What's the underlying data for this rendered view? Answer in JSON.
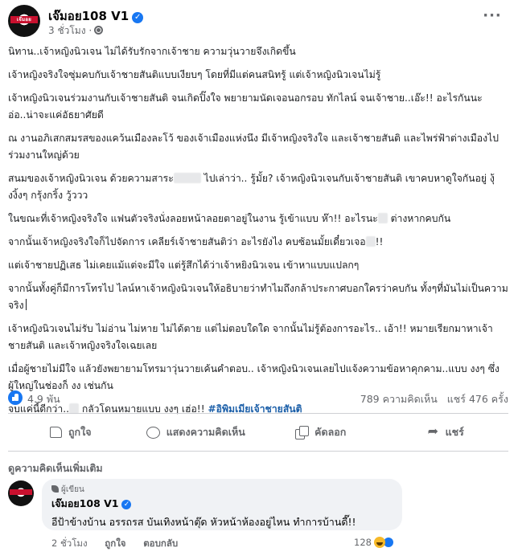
{
  "header": {
    "author": "เจ๊มอย108 V1",
    "avatar_text": "เจ๊มอย",
    "time": "3 ชั่วโมง",
    "more_label": "···"
  },
  "body": {
    "p1": "นิทาน..เจ้าหญิงนิวเจน ไม่ได้รับรักจากเจ้าชาย ความวุ่นวายจึงเกิดขึ้น",
    "p2": "เจ้าหญิงจริงใจซุ่มคบกับเจ้าชายสันติแบบเงียบๆ โดยที่มีแต่คนสนิทรู้ แต่เจ้าหญิงนิวเจนไม่รู้",
    "p3": "เจ้าหญิงนิวเจนร่วมงานกับเจ้าชายสันติ จนเกิดปิ๊งใจ พยายามนัดเจอนอกรอบ ทักไลน์ จนเจ้าชาย..เอ๊ะ!! อะไรกันนะ อ่อ..น่าจะแค่อัธยาศัยดี",
    "p4": "ณ งานอภิเสกสมรสของแคว้นเมืองละโว้ ของเจ้าเมืองแห่งนึง มีเจ้าหญิงจริงใจ และเจ้าชายสันติ และไพร่ฟ้าต่างเมืองไปร่วมงานใหญ่ด้วย",
    "p5a": "สนมของเจ้าหญิงนิวเจน ด้วยความสาระ",
    "p5b": "ไปเล่าว่า.. รู้มั้ย? เจ้าหญิงนิวเจนกับเจ้าชายสันติ เขาคบหาดูใจกันอยู่ งุ้งงิ้งๆ กรุ้งกริ้ง วู้ววว",
    "p6a": "ในขณะที่เจ้าหญิงจริงใจ แฟนตัวจริงนั่งลอยหน้าลอยตาอยู่ในงาน รู้เข้าแบบ ห๊า!! อะไรนะ",
    "p6b": "ต่างหากคบกัน",
    "p7a": "จากนั้นเจ้าหญิงจริงใจก็ไปจัดการ เคลียร์เจ้าชายสันติว่า อะไรยังไง คบซ้อนมั้ยเดี๋ยวเจอ",
    "p7b": "!!",
    "p8": "แต่เจ้าชายปฏิเสธ ไม่เคยแม้แต่จะมีใจ แต่รู้สึกได้ว่าเจ้าหยิงนิวเจน เข้าหาแบบแปลกๆ",
    "p9": "จากนั้นทั้งคู่ก็มีการโทรไป ไลน์หาเจ้าหญิงนิวเจนให้อธิบายว่าทำไมถึงกล้าประกาศบอกใครว่าคบกัน ทั้งๆที่มันไม่เป็นความจริง",
    "p10": "เจ้าหญิงนิวเจนไม่รับ ไม่อ่าน ไม่หาย ไม่ได้ตาย แต่ไม่ตอบใดใด จากนั้นไม่รู้ต้องการอะไร.. เอ้า!! หมายเรียกมาหาเจ้าชายสันติ และเจ้าหญิงจริงใจเฉยเลย",
    "p11": "เมื่อผู้ชายไม่มีใจ แล้วยังพยายามโทรมาวุ่นวายเค้นคำตอบ.. เจ้าหญิงนิวเจนเลยไปแจ้งความข้อหาคุกคาม..แบบ งงๆ ซึ่งผู้ใหญ่ในช่องก็ งง เช่นกัน",
    "p12a": "จบแค่นี้ดีกว่า..",
    "p12b": "กลัวโดนหมายแบบ งงๆ เฮ่อ!!",
    "hashtag": "#อิพิมเมียเจ้าชายสันติ"
  },
  "stats": {
    "reactions": "4.9 พัน",
    "comments": "789 ความคิดเห็น",
    "shares": "แชร์ 476 ครั้ง"
  },
  "actions": {
    "like": "ถูกใจ",
    "comment": "แสดงความคิดเห็น",
    "copy": "คัดลอก",
    "share": "แชร์"
  },
  "comments_section": {
    "more_label": "ดูความคิดเห็นเพิ่มเติม",
    "comment": {
      "badge": "ผู้เขียน",
      "author": "เจ๊มอย108 V1",
      "text": "อีป้าข้างบ้าน อรรถรส บันเทิงหน้าตุ๊ด หัวหน้าห้องอยู่ไหน ทำการบ้านดี๊!!",
      "time": "2 ชั่วโมง",
      "like": "ถูกใจ",
      "reply": "ตอบกลับ",
      "reaction_count": "128"
    }
  },
  "colors": {
    "accent": "#1877f2",
    "hashtag": "#1a5ea8",
    "muted": "#65676b",
    "bubble": "#f0f2f5"
  }
}
